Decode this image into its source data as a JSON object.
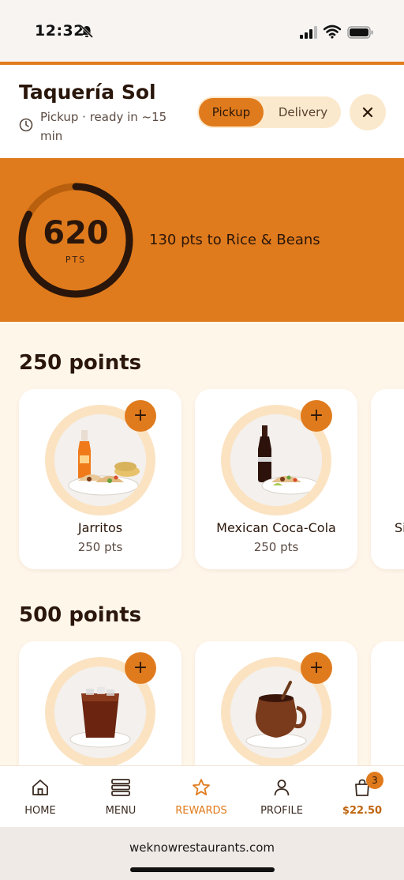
{
  "status_bar": {
    "time": "12:32"
  },
  "header": {
    "restaurant_name": "Taquería Sol",
    "pickup_info": "Pickup · ready in ~15 min",
    "toggle": {
      "pickup": "Pickup",
      "delivery": "Delivery",
      "selected": "Pickup"
    }
  },
  "points": {
    "value": "620",
    "unit": "PTS",
    "next_reward_text": "130 pts to Rice & Beans",
    "progress_fraction": 0.83
  },
  "sections": [
    {
      "title": "250 points",
      "items": [
        {
          "name": "Jarritos",
          "points": "250 pts",
          "icon": "jarritos-tacos-image"
        },
        {
          "name": "Mexican Coca-Cola",
          "points": "250 pts",
          "icon": "coca-cola-tacos-image"
        },
        {
          "name": "Si",
          "points": "",
          "icon": ""
        }
      ]
    },
    {
      "title": "500 points",
      "items": [
        {
          "name": "",
          "points": "",
          "icon": "iced-drink-image"
        },
        {
          "name": "",
          "points": "",
          "icon": "clay-mug-image"
        }
      ]
    }
  ],
  "bottom_nav": [
    {
      "label": "HOME",
      "icon": "home-icon"
    },
    {
      "label": "MENU",
      "icon": "menu-icon"
    },
    {
      "label": "REWARDS",
      "icon": "star-icon",
      "active": true
    },
    {
      "label": "PROFILE",
      "icon": "person-icon"
    },
    {
      "label": "$22.50",
      "icon": "bag-icon",
      "badge": "3"
    }
  ],
  "browser": {
    "url": "weknowrestaurants.com"
  },
  "colors": {
    "accent": "#e07b1d",
    "cream": "#fff6ea",
    "dark": "#2a160a"
  }
}
